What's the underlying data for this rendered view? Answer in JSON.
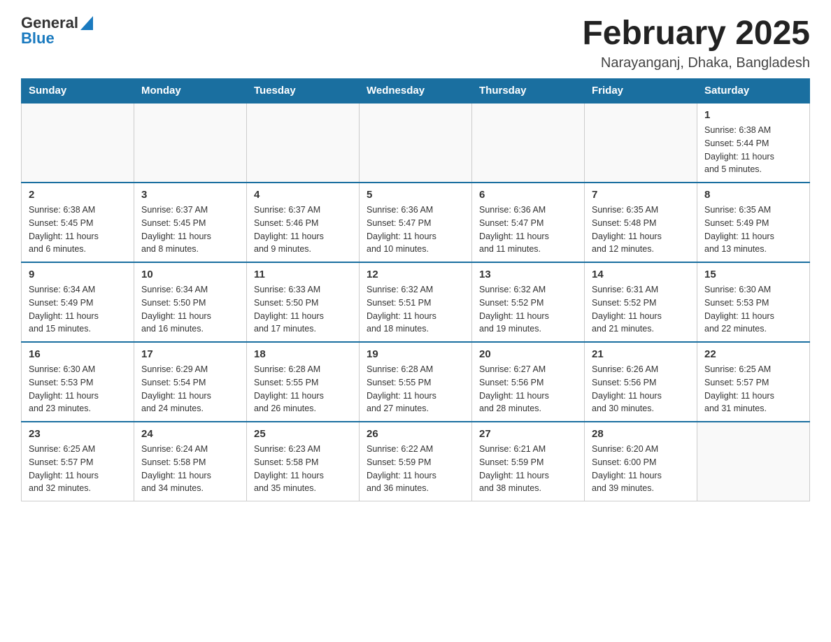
{
  "header": {
    "logo_general": "General",
    "logo_blue": "Blue",
    "month_title": "February 2025",
    "location": "Narayanganj, Dhaka, Bangladesh"
  },
  "days_of_week": [
    "Sunday",
    "Monday",
    "Tuesday",
    "Wednesday",
    "Thursday",
    "Friday",
    "Saturday"
  ],
  "weeks": [
    {
      "days": [
        {
          "number": "",
          "info": "",
          "empty": true
        },
        {
          "number": "",
          "info": "",
          "empty": true
        },
        {
          "number": "",
          "info": "",
          "empty": true
        },
        {
          "number": "",
          "info": "",
          "empty": true
        },
        {
          "number": "",
          "info": "",
          "empty": true
        },
        {
          "number": "",
          "info": "",
          "empty": true
        },
        {
          "number": "1",
          "info": "Sunrise: 6:38 AM\nSunset: 5:44 PM\nDaylight: 11 hours\nand 5 minutes."
        }
      ]
    },
    {
      "days": [
        {
          "number": "2",
          "info": "Sunrise: 6:38 AM\nSunset: 5:45 PM\nDaylight: 11 hours\nand 6 minutes."
        },
        {
          "number": "3",
          "info": "Sunrise: 6:37 AM\nSunset: 5:45 PM\nDaylight: 11 hours\nand 8 minutes."
        },
        {
          "number": "4",
          "info": "Sunrise: 6:37 AM\nSunset: 5:46 PM\nDaylight: 11 hours\nand 9 minutes."
        },
        {
          "number": "5",
          "info": "Sunrise: 6:36 AM\nSunset: 5:47 PM\nDaylight: 11 hours\nand 10 minutes."
        },
        {
          "number": "6",
          "info": "Sunrise: 6:36 AM\nSunset: 5:47 PM\nDaylight: 11 hours\nand 11 minutes."
        },
        {
          "number": "7",
          "info": "Sunrise: 6:35 AM\nSunset: 5:48 PM\nDaylight: 11 hours\nand 12 minutes."
        },
        {
          "number": "8",
          "info": "Sunrise: 6:35 AM\nSunset: 5:49 PM\nDaylight: 11 hours\nand 13 minutes."
        }
      ]
    },
    {
      "days": [
        {
          "number": "9",
          "info": "Sunrise: 6:34 AM\nSunset: 5:49 PM\nDaylight: 11 hours\nand 15 minutes."
        },
        {
          "number": "10",
          "info": "Sunrise: 6:34 AM\nSunset: 5:50 PM\nDaylight: 11 hours\nand 16 minutes."
        },
        {
          "number": "11",
          "info": "Sunrise: 6:33 AM\nSunset: 5:50 PM\nDaylight: 11 hours\nand 17 minutes."
        },
        {
          "number": "12",
          "info": "Sunrise: 6:32 AM\nSunset: 5:51 PM\nDaylight: 11 hours\nand 18 minutes."
        },
        {
          "number": "13",
          "info": "Sunrise: 6:32 AM\nSunset: 5:52 PM\nDaylight: 11 hours\nand 19 minutes."
        },
        {
          "number": "14",
          "info": "Sunrise: 6:31 AM\nSunset: 5:52 PM\nDaylight: 11 hours\nand 21 minutes."
        },
        {
          "number": "15",
          "info": "Sunrise: 6:30 AM\nSunset: 5:53 PM\nDaylight: 11 hours\nand 22 minutes."
        }
      ]
    },
    {
      "days": [
        {
          "number": "16",
          "info": "Sunrise: 6:30 AM\nSunset: 5:53 PM\nDaylight: 11 hours\nand 23 minutes."
        },
        {
          "number": "17",
          "info": "Sunrise: 6:29 AM\nSunset: 5:54 PM\nDaylight: 11 hours\nand 24 minutes."
        },
        {
          "number": "18",
          "info": "Sunrise: 6:28 AM\nSunset: 5:55 PM\nDaylight: 11 hours\nand 26 minutes."
        },
        {
          "number": "19",
          "info": "Sunrise: 6:28 AM\nSunset: 5:55 PM\nDaylight: 11 hours\nand 27 minutes."
        },
        {
          "number": "20",
          "info": "Sunrise: 6:27 AM\nSunset: 5:56 PM\nDaylight: 11 hours\nand 28 minutes."
        },
        {
          "number": "21",
          "info": "Sunrise: 6:26 AM\nSunset: 5:56 PM\nDaylight: 11 hours\nand 30 minutes."
        },
        {
          "number": "22",
          "info": "Sunrise: 6:25 AM\nSunset: 5:57 PM\nDaylight: 11 hours\nand 31 minutes."
        }
      ]
    },
    {
      "days": [
        {
          "number": "23",
          "info": "Sunrise: 6:25 AM\nSunset: 5:57 PM\nDaylight: 11 hours\nand 32 minutes."
        },
        {
          "number": "24",
          "info": "Sunrise: 6:24 AM\nSunset: 5:58 PM\nDaylight: 11 hours\nand 34 minutes."
        },
        {
          "number": "25",
          "info": "Sunrise: 6:23 AM\nSunset: 5:58 PM\nDaylight: 11 hours\nand 35 minutes."
        },
        {
          "number": "26",
          "info": "Sunrise: 6:22 AM\nSunset: 5:59 PM\nDaylight: 11 hours\nand 36 minutes."
        },
        {
          "number": "27",
          "info": "Sunrise: 6:21 AM\nSunset: 5:59 PM\nDaylight: 11 hours\nand 38 minutes."
        },
        {
          "number": "28",
          "info": "Sunrise: 6:20 AM\nSunset: 6:00 PM\nDaylight: 11 hours\nand 39 minutes."
        },
        {
          "number": "",
          "info": "",
          "empty": true
        }
      ]
    }
  ]
}
